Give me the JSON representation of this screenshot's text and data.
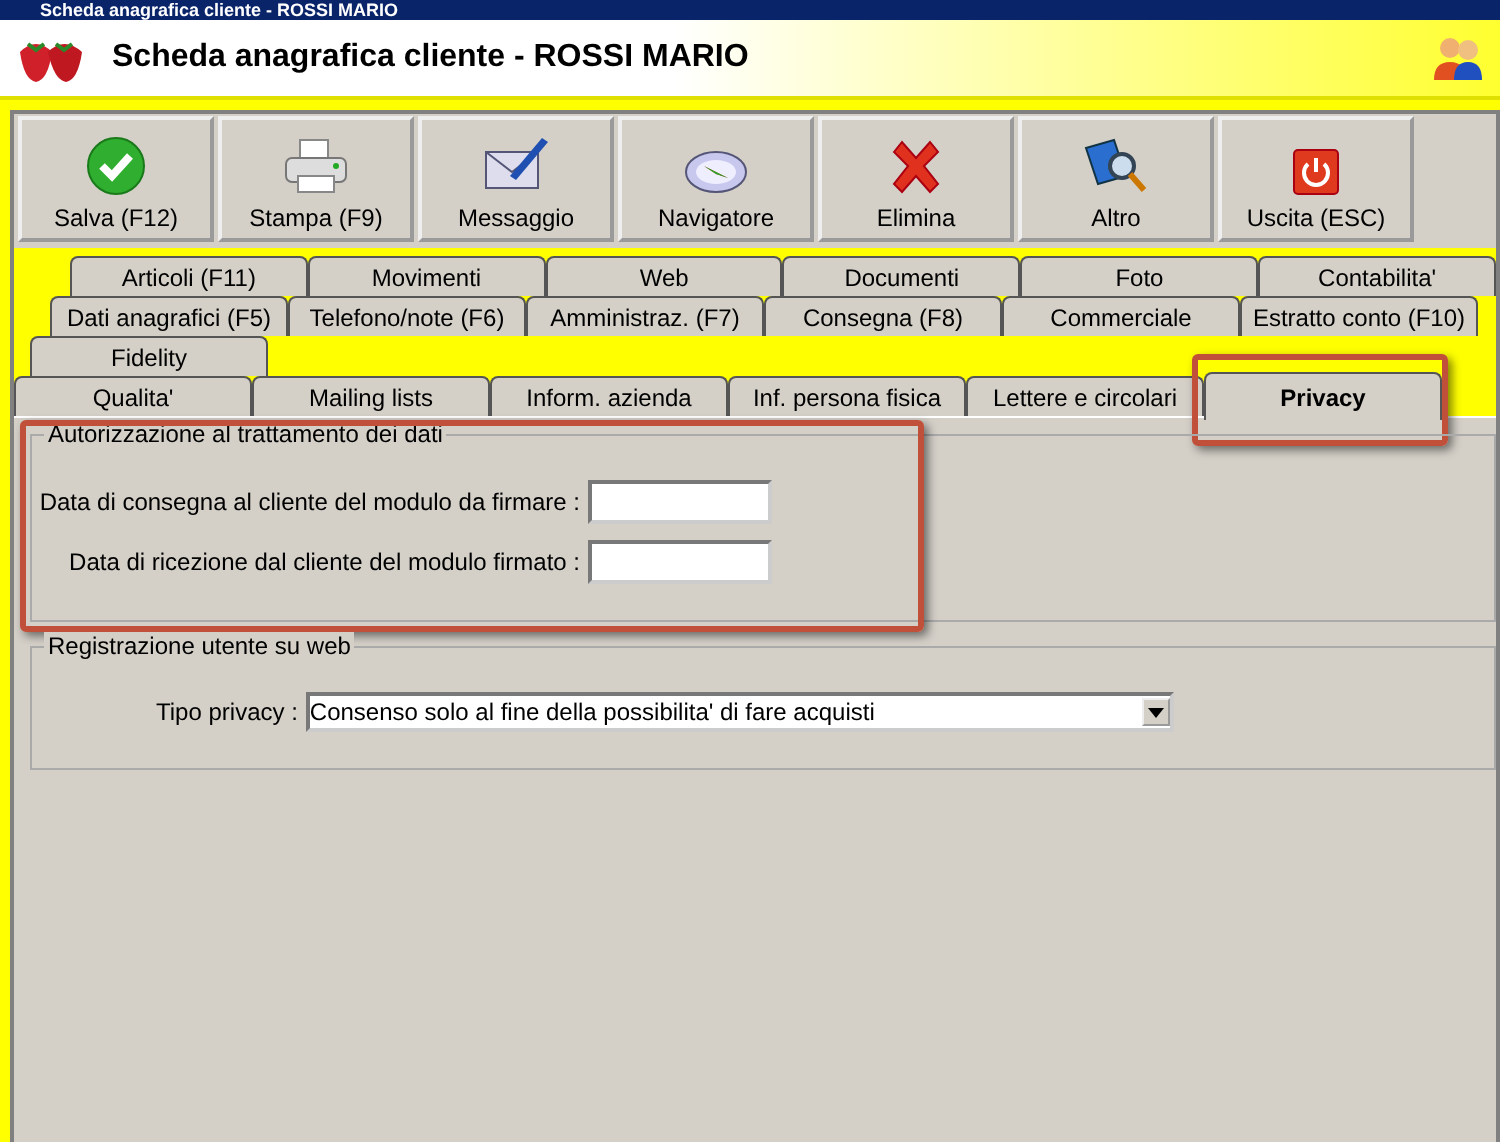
{
  "window": {
    "title": "Scheda anagrafica cliente - ROSSI MARIO"
  },
  "header": {
    "title": "Scheda anagrafica cliente - ROSSI MARIO"
  },
  "toolbar": [
    {
      "label": "Salva (F12)",
      "kind": "save"
    },
    {
      "label": "Stampa (F9)",
      "kind": "print"
    },
    {
      "label": "Messaggio",
      "kind": "message"
    },
    {
      "label": "Navigatore",
      "kind": "navigator"
    },
    {
      "label": "Elimina",
      "kind": "delete"
    },
    {
      "label": "Altro",
      "kind": "other"
    },
    {
      "label": "Uscita (ESC)",
      "kind": "exit"
    }
  ],
  "tab_rows": [
    [
      {
        "label": "Articoli (F11)",
        "selected": false
      },
      {
        "label": "Movimenti",
        "selected": false
      },
      {
        "label": "Web",
        "selected": false
      },
      {
        "label": "Documenti",
        "selected": false
      },
      {
        "label": "Foto",
        "selected": false
      },
      {
        "label": "Contabilita'",
        "selected": false
      }
    ],
    [
      {
        "label": "Dati anagrafici (F5)",
        "selected": false
      },
      {
        "label": "Telefono/note (F6)",
        "selected": false
      },
      {
        "label": "Amministraz. (F7)",
        "selected": false
      },
      {
        "label": "Consegna (F8)",
        "selected": false
      },
      {
        "label": "Commerciale",
        "selected": false
      },
      {
        "label": "Estratto conto (F10)",
        "selected": false
      }
    ],
    [
      {
        "label": "Fidelity",
        "selected": false
      }
    ],
    [
      {
        "label": "Qualita'",
        "selected": false
      },
      {
        "label": "Mailing lists",
        "selected": false
      },
      {
        "label": "Inform. azienda",
        "selected": false
      },
      {
        "label": "Inf. persona fisica",
        "selected": false
      },
      {
        "label": "Lettere e circolari",
        "selected": false
      },
      {
        "label": "Privacy",
        "selected": true
      }
    ]
  ],
  "sections": [
    {
      "title": "Autorizzazione al trattamento dei dati",
      "fields": [
        {
          "kind": "date",
          "label": "Data di consegna al cliente del modulo da firmare :"
        },
        {
          "kind": "date",
          "label": "Data di ricezione dal cliente del modulo firmato :"
        }
      ]
    },
    {
      "title": "Registrazione utente su web",
      "fields": [
        {
          "kind": "dropdown",
          "label": "Tipo privacy :",
          "value": "Consenso solo al fine della possibilita' di fare acquisti"
        }
      ]
    }
  ]
}
